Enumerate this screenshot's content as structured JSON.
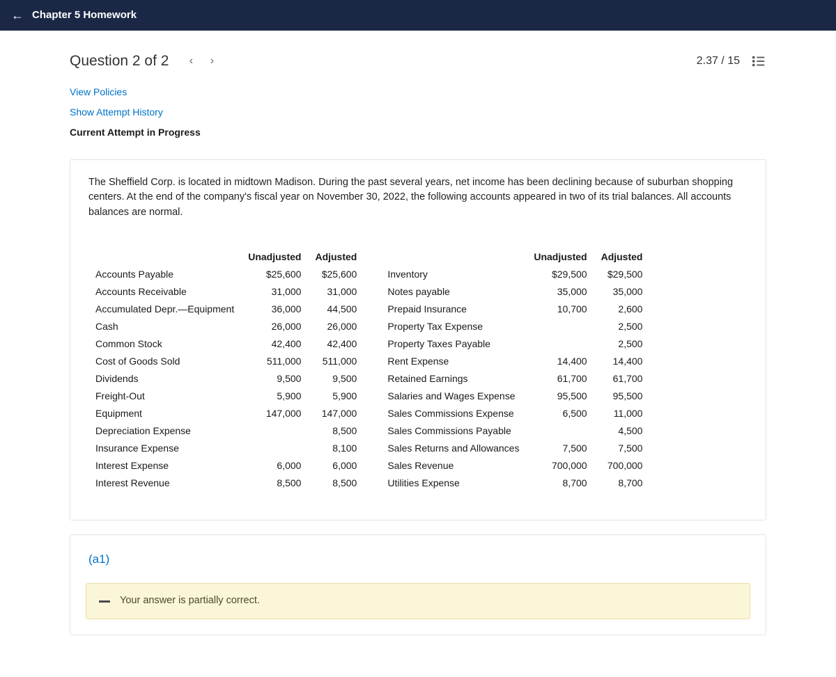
{
  "top": {
    "title": "Chapter 5 Homework"
  },
  "question": {
    "title": "Question 2 of 2",
    "score": "2.37 / 15"
  },
  "links": {
    "policies": "View Policies",
    "history": "Show Attempt History",
    "status": "Current Attempt in Progress"
  },
  "problem": {
    "text": "The Sheffield Corp. is located in midtown Madison. During the past several years, net income has been declining because of suburban shopping centers. At the end of the company's fiscal year on November 30, 2022, the following accounts appeared in two of its trial balances. All accounts balances are normal."
  },
  "tableHeaders": {
    "unadjusted": "Unadjusted",
    "adjusted": "Adjusted"
  },
  "left": [
    {
      "name": "Accounts Payable",
      "un": "$25,600",
      "adj": "$25,600"
    },
    {
      "name": "Accounts Receivable",
      "un": "31,000",
      "adj": "31,000"
    },
    {
      "name": "Accumulated Depr.—Equipment",
      "un": "36,000",
      "adj": "44,500"
    },
    {
      "name": "Cash",
      "un": "26,000",
      "adj": "26,000"
    },
    {
      "name": "Common Stock",
      "un": "42,400",
      "adj": "42,400"
    },
    {
      "name": "Cost of Goods Sold",
      "un": "511,000",
      "adj": "511,000"
    },
    {
      "name": "Dividends",
      "un": "9,500",
      "adj": "9,500"
    },
    {
      "name": "Freight-Out",
      "un": "5,900",
      "adj": "5,900"
    },
    {
      "name": "Equipment",
      "un": "147,000",
      "adj": "147,000"
    },
    {
      "name": "Depreciation Expense",
      "un": "",
      "adj": "8,500"
    },
    {
      "name": "Insurance Expense",
      "un": "",
      "adj": "8,100"
    },
    {
      "name": "Interest Expense",
      "un": "6,000",
      "adj": "6,000"
    },
    {
      "name": "Interest Revenue",
      "un": "8,500",
      "adj": "8,500"
    }
  ],
  "right": [
    {
      "name": "Inventory",
      "un": "$29,500",
      "adj": "$29,500"
    },
    {
      "name": "Notes payable",
      "un": "35,000",
      "adj": "35,000"
    },
    {
      "name": "Prepaid Insurance",
      "un": "10,700",
      "adj": "2,600"
    },
    {
      "name": "Property Tax Expense",
      "un": "",
      "adj": "2,500"
    },
    {
      "name": "Property Taxes Payable",
      "un": "",
      "adj": "2,500"
    },
    {
      "name": "Rent Expense",
      "un": "14,400",
      "adj": "14,400"
    },
    {
      "name": "Retained Earnings",
      "un": "61,700",
      "adj": "61,700"
    },
    {
      "name": "Salaries and Wages Expense",
      "un": "95,500",
      "adj": "95,500"
    },
    {
      "name": "Sales Commissions Expense",
      "un": "6,500",
      "adj": "11,000"
    },
    {
      "name": "Sales Commissions Payable",
      "un": "",
      "adj": "4,500"
    },
    {
      "name": "Sales Returns and Allowances",
      "un": "7,500",
      "adj": "7,500"
    },
    {
      "name": "Sales Revenue",
      "un": "700,000",
      "adj": "700,000"
    },
    {
      "name": "Utilities Expense",
      "un": "8,700",
      "adj": "8,700"
    }
  ],
  "part": {
    "label": "(a1)"
  },
  "alert": {
    "text": "Your answer is partially correct."
  }
}
